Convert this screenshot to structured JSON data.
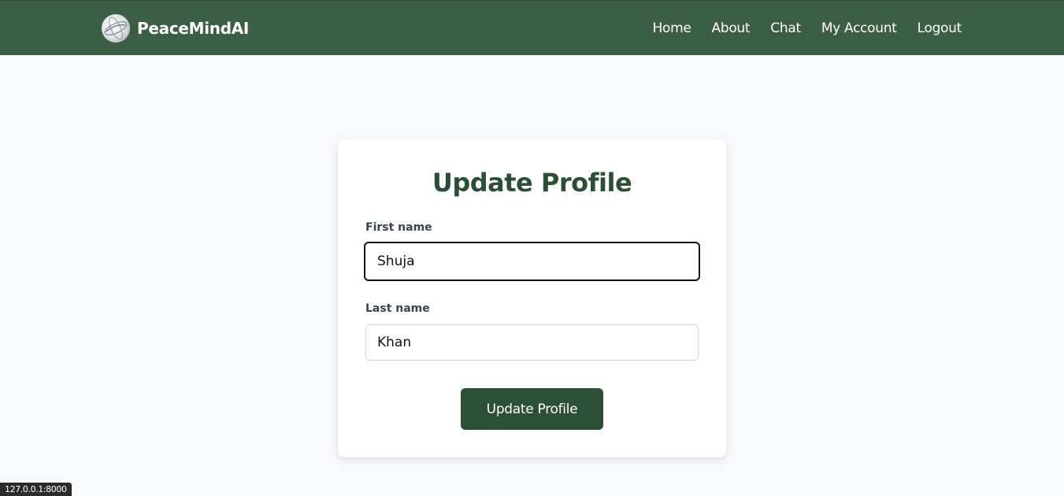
{
  "brand": {
    "name": "PeaceMindAI",
    "logo_icon": "globe-logo-icon"
  },
  "nav": {
    "items": [
      {
        "label": "Home"
      },
      {
        "label": "About"
      },
      {
        "label": "Chat"
      },
      {
        "label": "My Account"
      },
      {
        "label": "Logout"
      }
    ]
  },
  "form": {
    "title": "Update Profile",
    "first_name": {
      "label": "First name",
      "value": "Shuja",
      "focused": true
    },
    "last_name": {
      "label": "Last name",
      "value": "Khan"
    },
    "submit_label": "Update Profile"
  },
  "status_bar": {
    "url": "127.0.0.1:8000"
  },
  "colors": {
    "navbar": "#3d5e46",
    "title": "#2d4d36",
    "button": "#2d4f37",
    "background": "#f8f9fb"
  }
}
